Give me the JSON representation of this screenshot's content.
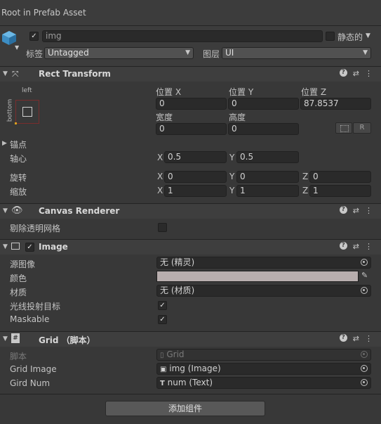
{
  "window": {
    "title": "Root in Prefab Asset"
  },
  "gameobject": {
    "active": true,
    "name": "img",
    "static_label": "静态的",
    "tag_label": "标签",
    "tag_value": "Untagged",
    "layer_label": "图层",
    "layer_value": "UI"
  },
  "rect_transform": {
    "title": "Rect Transform",
    "anchor_preset_h": "left",
    "anchor_preset_v": "bottom",
    "pos_x_label": "位置 X",
    "pos_y_label": "位置 Y",
    "pos_z_label": "位置 Z",
    "pos_x": "0",
    "pos_y": "0",
    "pos_z": "87.8537",
    "width_label": "宽度",
    "height_label": "高度",
    "width": "0",
    "height": "0",
    "r_button": "R",
    "anchors_label": "锚点",
    "pivot_label": "轴心",
    "pivot_x": "0.5",
    "pivot_y": "0.5",
    "rotation_label": "旋转",
    "rot_x": "0",
    "rot_y": "0",
    "rot_z": "0",
    "scale_label": "缩放",
    "scale_x": "1",
    "scale_y": "1",
    "scale_z": "1",
    "axis_x": "X",
    "axis_y": "Y",
    "axis_z": "Z"
  },
  "canvas_renderer": {
    "title": "Canvas Renderer",
    "cull_label": "剔除透明网格",
    "cull_checked": false
  },
  "image": {
    "title": "Image",
    "enabled": true,
    "source_label": "源图像",
    "source_value": "无 (精灵)",
    "color_label": "颜色",
    "color_value": "#b8aeae",
    "material_label": "材质",
    "material_value": "无 (材质)",
    "raycast_label": "光线投射目标",
    "raycast_checked": true,
    "maskable_label": "Maskable",
    "maskable_checked": true
  },
  "grid_script": {
    "title": "Grid （脚本）",
    "script_label": "脚本",
    "script_value": "Grid",
    "grid_image_label": "Grid Image",
    "grid_image_value": "img (Image)",
    "grid_num_label": "Gird Num",
    "grid_num_value": "num (Text)"
  },
  "footer": {
    "add_component": "添加组件"
  },
  "check_glyph": "✓"
}
